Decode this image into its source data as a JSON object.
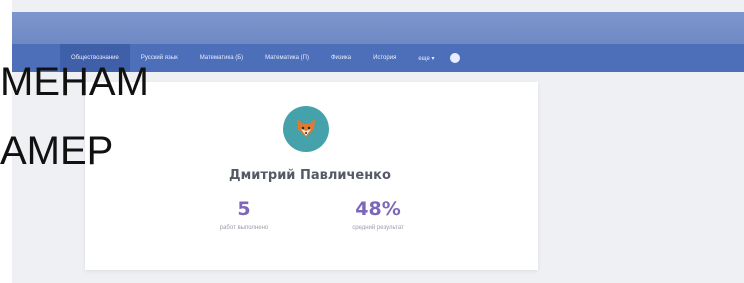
{
  "nav": {
    "tabs": [
      {
        "label": "Обществознание",
        "active": true
      },
      {
        "label": "Русский язык",
        "active": false
      },
      {
        "label": "Математика (Б)",
        "active": false
      },
      {
        "label": "Математика (П)",
        "active": false
      },
      {
        "label": "Физика",
        "active": false
      },
      {
        "label": "История",
        "active": false
      },
      {
        "label": "еще ▾",
        "active": false
      }
    ],
    "settings_icon": "gear-icon"
  },
  "profile": {
    "name": "Дмитрий Павличенко",
    "avatar_icon": "fox-icon",
    "stats": [
      {
        "value": "5",
        "label": "работ выполнено"
      },
      {
        "value": "48%",
        "label": "средний результат"
      }
    ]
  },
  "overlay": {
    "line1": "МЕНАМ",
    "line2": "АМЕР"
  },
  "colors": {
    "nav": "#4d6fba",
    "header": "#7d96ce",
    "accent": "#7d67b8",
    "avatar_bg": "#45a1aa"
  }
}
